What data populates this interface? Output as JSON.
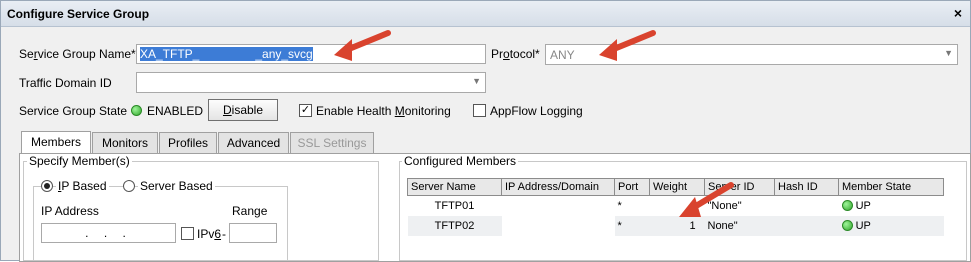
{
  "window": {
    "title": "Configure Service Group",
    "close_glyph": "×"
  },
  "form": {
    "service_group_name": {
      "label_pre": "Se",
      "label_accel": "r",
      "label_post": "vice Group Name*",
      "value_prefix": "XA_TFTP_",
      "value_suffix": "_any_svcg"
    },
    "protocol": {
      "label_pre": "Pr",
      "label_accel": "o",
      "label_post": "tocol*",
      "value": "ANY"
    },
    "traffic_domain": {
      "label": "Traffic Domain ID",
      "value": ""
    },
    "state": {
      "label": "Service Group State",
      "value": "ENABLED",
      "status_color": "#2fa52a"
    },
    "disable_button": {
      "accel": "D",
      "rest": "isable"
    },
    "health_monitoring": {
      "label_pre": "Enable Health ",
      "label_accel": "M",
      "label_post": "onitoring",
      "checked": true
    },
    "appflow": {
      "label": "AppFlow Logging",
      "checked": false
    }
  },
  "tabs": [
    {
      "label": "Members",
      "active": true
    },
    {
      "label": "Monitors",
      "active": false
    },
    {
      "label": "Profiles",
      "active": false
    },
    {
      "label": "Advanced",
      "active": false
    },
    {
      "label": "SSL Settings",
      "active": false,
      "disabled": true
    }
  ],
  "specify_members": {
    "legend": "Specify Member(s)",
    "ip_based": {
      "label_accel": "I",
      "label_rest": "P Based",
      "selected": true
    },
    "server_based": {
      "label": "Server Based",
      "selected": false
    },
    "ip_address_label": "IP Address",
    "range_label": "Range",
    "ip_dots": ".   .   .",
    "ipv6_label_pre": "IPv",
    "ipv6_label_accel": "6",
    "ipv6_dash": "-"
  },
  "configured_members": {
    "legend": "Configured Members",
    "columns": [
      "Server Name",
      "IP Address/Domain",
      "Port",
      "Weight",
      "Server ID",
      "Hash ID",
      "Member State"
    ],
    "rows": [
      {
        "server_name": "TFTP01",
        "ip": "",
        "port": "*",
        "weight": "1",
        "server_id": "\"None\"",
        "hash_id": "",
        "state": "UP"
      },
      {
        "server_name": "TFTP02",
        "ip": "",
        "port": "*",
        "weight": "1",
        "server_id": "None\"",
        "hash_id": "",
        "state": "UP"
      }
    ]
  },
  "colors": {
    "annotation_arrow": "#d9432e",
    "up_indicator": "#2fa52a",
    "selection": "#3d7cd6"
  }
}
